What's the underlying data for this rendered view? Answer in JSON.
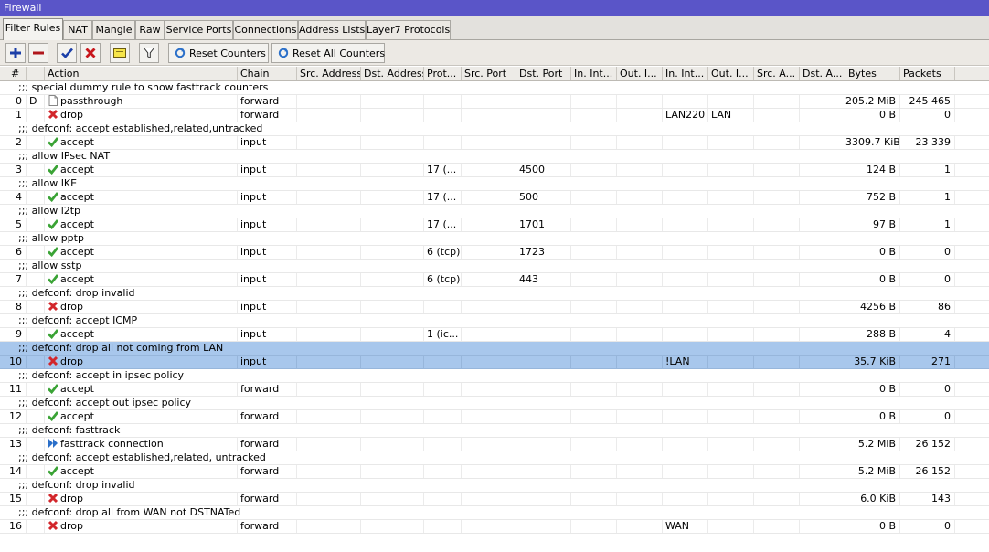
{
  "window": {
    "title": "Firewall"
  },
  "tabs": [
    "Filter Rules",
    "NAT",
    "Mangle",
    "Raw",
    "Service Ports",
    "Connections",
    "Address Lists",
    "Layer7 Protocols"
  ],
  "toolbar": {
    "reset_counters": "Reset Counters",
    "reset_all_counters": "Reset All Counters"
  },
  "columns": [
    "#",
    "Action",
    "Chain",
    "Src. Address",
    "Dst. Address",
    "Prot...",
    "Src. Port",
    "Dst. Port",
    "In. Int...",
    "Out. I...",
    "In. Int...",
    "Out. I...",
    "Src. A...",
    "Dst. A...",
    "Bytes",
    "Packets"
  ],
  "rows": [
    {
      "type": "comment",
      "text": ";;; special dummy rule to show fasttrack counters"
    },
    {
      "type": "rule",
      "num": "0",
      "flag": "D",
      "icon": "passthrough",
      "action": "passthrough",
      "chain": "forward",
      "proto": "",
      "dst_port": "",
      "in_if_list": "",
      "out_if_list": "",
      "bytes": "205.2 MiB",
      "packets": "245 465"
    },
    {
      "type": "rule",
      "num": "1",
      "flag": "",
      "icon": "drop",
      "action": "drop",
      "chain": "forward",
      "proto": "",
      "dst_port": "",
      "in_if_list": "LAN220",
      "out_if_list": "LAN",
      "bytes": "0 B",
      "packets": "0"
    },
    {
      "type": "comment",
      "text": ";;; defconf: accept established,related,untracked"
    },
    {
      "type": "rule",
      "num": "2",
      "flag": "",
      "icon": "accept",
      "action": "accept",
      "chain": "input",
      "proto": "",
      "dst_port": "",
      "in_if_list": "",
      "out_if_list": "",
      "bytes": "3309.7 KiB",
      "packets": "23 339"
    },
    {
      "type": "comment",
      "text": ";;; allow IPsec NAT"
    },
    {
      "type": "rule",
      "num": "3",
      "flag": "",
      "icon": "accept",
      "action": "accept",
      "chain": "input",
      "proto": "17 (...",
      "dst_port": "4500",
      "in_if_list": "",
      "out_if_list": "",
      "bytes": "124 B",
      "packets": "1"
    },
    {
      "type": "comment",
      "text": ";;; allow IKE"
    },
    {
      "type": "rule",
      "num": "4",
      "flag": "",
      "icon": "accept",
      "action": "accept",
      "chain": "input",
      "proto": "17 (...",
      "dst_port": "500",
      "in_if_list": "",
      "out_if_list": "",
      "bytes": "752 B",
      "packets": "1"
    },
    {
      "type": "comment",
      "text": ";;; allow l2tp"
    },
    {
      "type": "rule",
      "num": "5",
      "flag": "",
      "icon": "accept",
      "action": "accept",
      "chain": "input",
      "proto": "17 (...",
      "dst_port": "1701",
      "in_if_list": "",
      "out_if_list": "",
      "bytes": "97 B",
      "packets": "1"
    },
    {
      "type": "comment",
      "text": ";;; allow pptp"
    },
    {
      "type": "rule",
      "num": "6",
      "flag": "",
      "icon": "accept",
      "action": "accept",
      "chain": "input",
      "proto": "6 (tcp)",
      "dst_port": "1723",
      "in_if_list": "",
      "out_if_list": "",
      "bytes": "0 B",
      "packets": "0"
    },
    {
      "type": "comment",
      "text": ";;; allow sstp"
    },
    {
      "type": "rule",
      "num": "7",
      "flag": "",
      "icon": "accept",
      "action": "accept",
      "chain": "input",
      "proto": "6 (tcp)",
      "dst_port": "443",
      "in_if_list": "",
      "out_if_list": "",
      "bytes": "0 B",
      "packets": "0"
    },
    {
      "type": "comment",
      "text": ";;; defconf: drop invalid"
    },
    {
      "type": "rule",
      "num": "8",
      "flag": "",
      "icon": "drop",
      "action": "drop",
      "chain": "input",
      "proto": "",
      "dst_port": "",
      "in_if_list": "",
      "out_if_list": "",
      "bytes": "4256 B",
      "packets": "86"
    },
    {
      "type": "comment",
      "text": ";;; defconf: accept ICMP"
    },
    {
      "type": "rule",
      "num": "9",
      "flag": "",
      "icon": "accept",
      "action": "accept",
      "chain": "input",
      "proto": "1 (ic...",
      "dst_port": "",
      "in_if_list": "",
      "out_if_list": "",
      "bytes": "288 B",
      "packets": "4"
    },
    {
      "type": "comment",
      "text": ";;; defconf: drop all not coming from LAN",
      "selected": true
    },
    {
      "type": "rule",
      "num": "10",
      "flag": "",
      "icon": "drop",
      "action": "drop",
      "chain": "input",
      "proto": "",
      "dst_port": "",
      "in_if_list": "!LAN",
      "out_if_list": "",
      "bytes": "35.7 KiB",
      "packets": "271",
      "selected": true
    },
    {
      "type": "comment",
      "text": ";;; defconf: accept in ipsec policy"
    },
    {
      "type": "rule",
      "num": "11",
      "flag": "",
      "icon": "accept",
      "action": "accept",
      "chain": "forward",
      "proto": "",
      "dst_port": "",
      "in_if_list": "",
      "out_if_list": "",
      "bytes": "0 B",
      "packets": "0"
    },
    {
      "type": "comment",
      "text": ";;; defconf: accept out ipsec policy"
    },
    {
      "type": "rule",
      "num": "12",
      "flag": "",
      "icon": "accept",
      "action": "accept",
      "chain": "forward",
      "proto": "",
      "dst_port": "",
      "in_if_list": "",
      "out_if_list": "",
      "bytes": "0 B",
      "packets": "0"
    },
    {
      "type": "comment",
      "text": ";;; defconf: fasttrack"
    },
    {
      "type": "rule",
      "num": "13",
      "flag": "",
      "icon": "fasttrack",
      "action": "fasttrack connection",
      "chain": "forward",
      "proto": "",
      "dst_port": "",
      "in_if_list": "",
      "out_if_list": "",
      "bytes": "5.2 MiB",
      "packets": "26 152"
    },
    {
      "type": "comment",
      "text": ";;; defconf: accept established,related, untracked"
    },
    {
      "type": "rule",
      "num": "14",
      "flag": "",
      "icon": "accept",
      "action": "accept",
      "chain": "forward",
      "proto": "",
      "dst_port": "",
      "in_if_list": "",
      "out_if_list": "",
      "bytes": "5.2 MiB",
      "packets": "26 152"
    },
    {
      "type": "comment",
      "text": ";;; defconf: drop invalid"
    },
    {
      "type": "rule",
      "num": "15",
      "flag": "",
      "icon": "drop",
      "action": "drop",
      "chain": "forward",
      "proto": "",
      "dst_port": "",
      "in_if_list": "",
      "out_if_list": "",
      "bytes": "6.0 KiB",
      "packets": "143"
    },
    {
      "type": "comment",
      "text": ";;; defconf:  drop all from WAN not DSTNATed"
    },
    {
      "type": "rule",
      "num": "16",
      "flag": "",
      "icon": "drop",
      "action": "drop",
      "chain": "forward",
      "proto": "",
      "dst_port": "",
      "in_if_list": "WAN",
      "out_if_list": "",
      "bytes": "0 B",
      "packets": "0"
    }
  ],
  "colors": {
    "title_bar": "#5a55c8",
    "selected_row": "#a8c7ec",
    "accept": "#3aa335",
    "drop": "#d2262b",
    "fasttrack": "#2a6fc9"
  }
}
